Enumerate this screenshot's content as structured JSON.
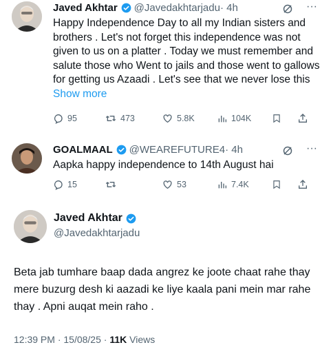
{
  "tweets": [
    {
      "name": "Javed Akhtar",
      "handle": "@Javedakhtarjadu",
      "time": "· 4h",
      "text": "Happy Independence Day to all my Indian sisters and brothers . Let's not forget this independence was not given to us on a platter . Today we must remember and salute those who Went to jails and those went to gallows for getting us Azaadi . Let's see that we never lose this",
      "show_more": "Show more",
      "replies": "95",
      "retweets": "473",
      "likes": "5.8K",
      "views": "104K"
    },
    {
      "name": "GOALMAAL",
      "handle": "@WEAREFUTURE4",
      "time": "· 4h",
      "text": "Aapka happy independence to 14th August hai",
      "replies": "15",
      "retweets": "",
      "likes": "53",
      "views": "7.4K"
    }
  ],
  "main": {
    "name": "Javed Akhtar",
    "handle": "@Javedakhtarjadu",
    "text": "Beta jab tumhare baap dada angrez ke joote chaat rahe thay mere buzurg desh ki aazadi ke liye kaala pani mein mar rahe thay . Apni auqat mein raho .",
    "footer_time": "12:39 PM · 15/08/25 · ",
    "footer_views_count": "11K",
    "footer_views_label": " Views"
  },
  "colors": {
    "verified": "#1d9bf0",
    "muted": "#536471",
    "link": "#1d9bf0"
  },
  "icons": [
    "reply-icon",
    "retweet-icon",
    "like-icon",
    "views-icon",
    "bookmark-icon",
    "share-icon",
    "grok-icon",
    "verified-icon"
  ]
}
